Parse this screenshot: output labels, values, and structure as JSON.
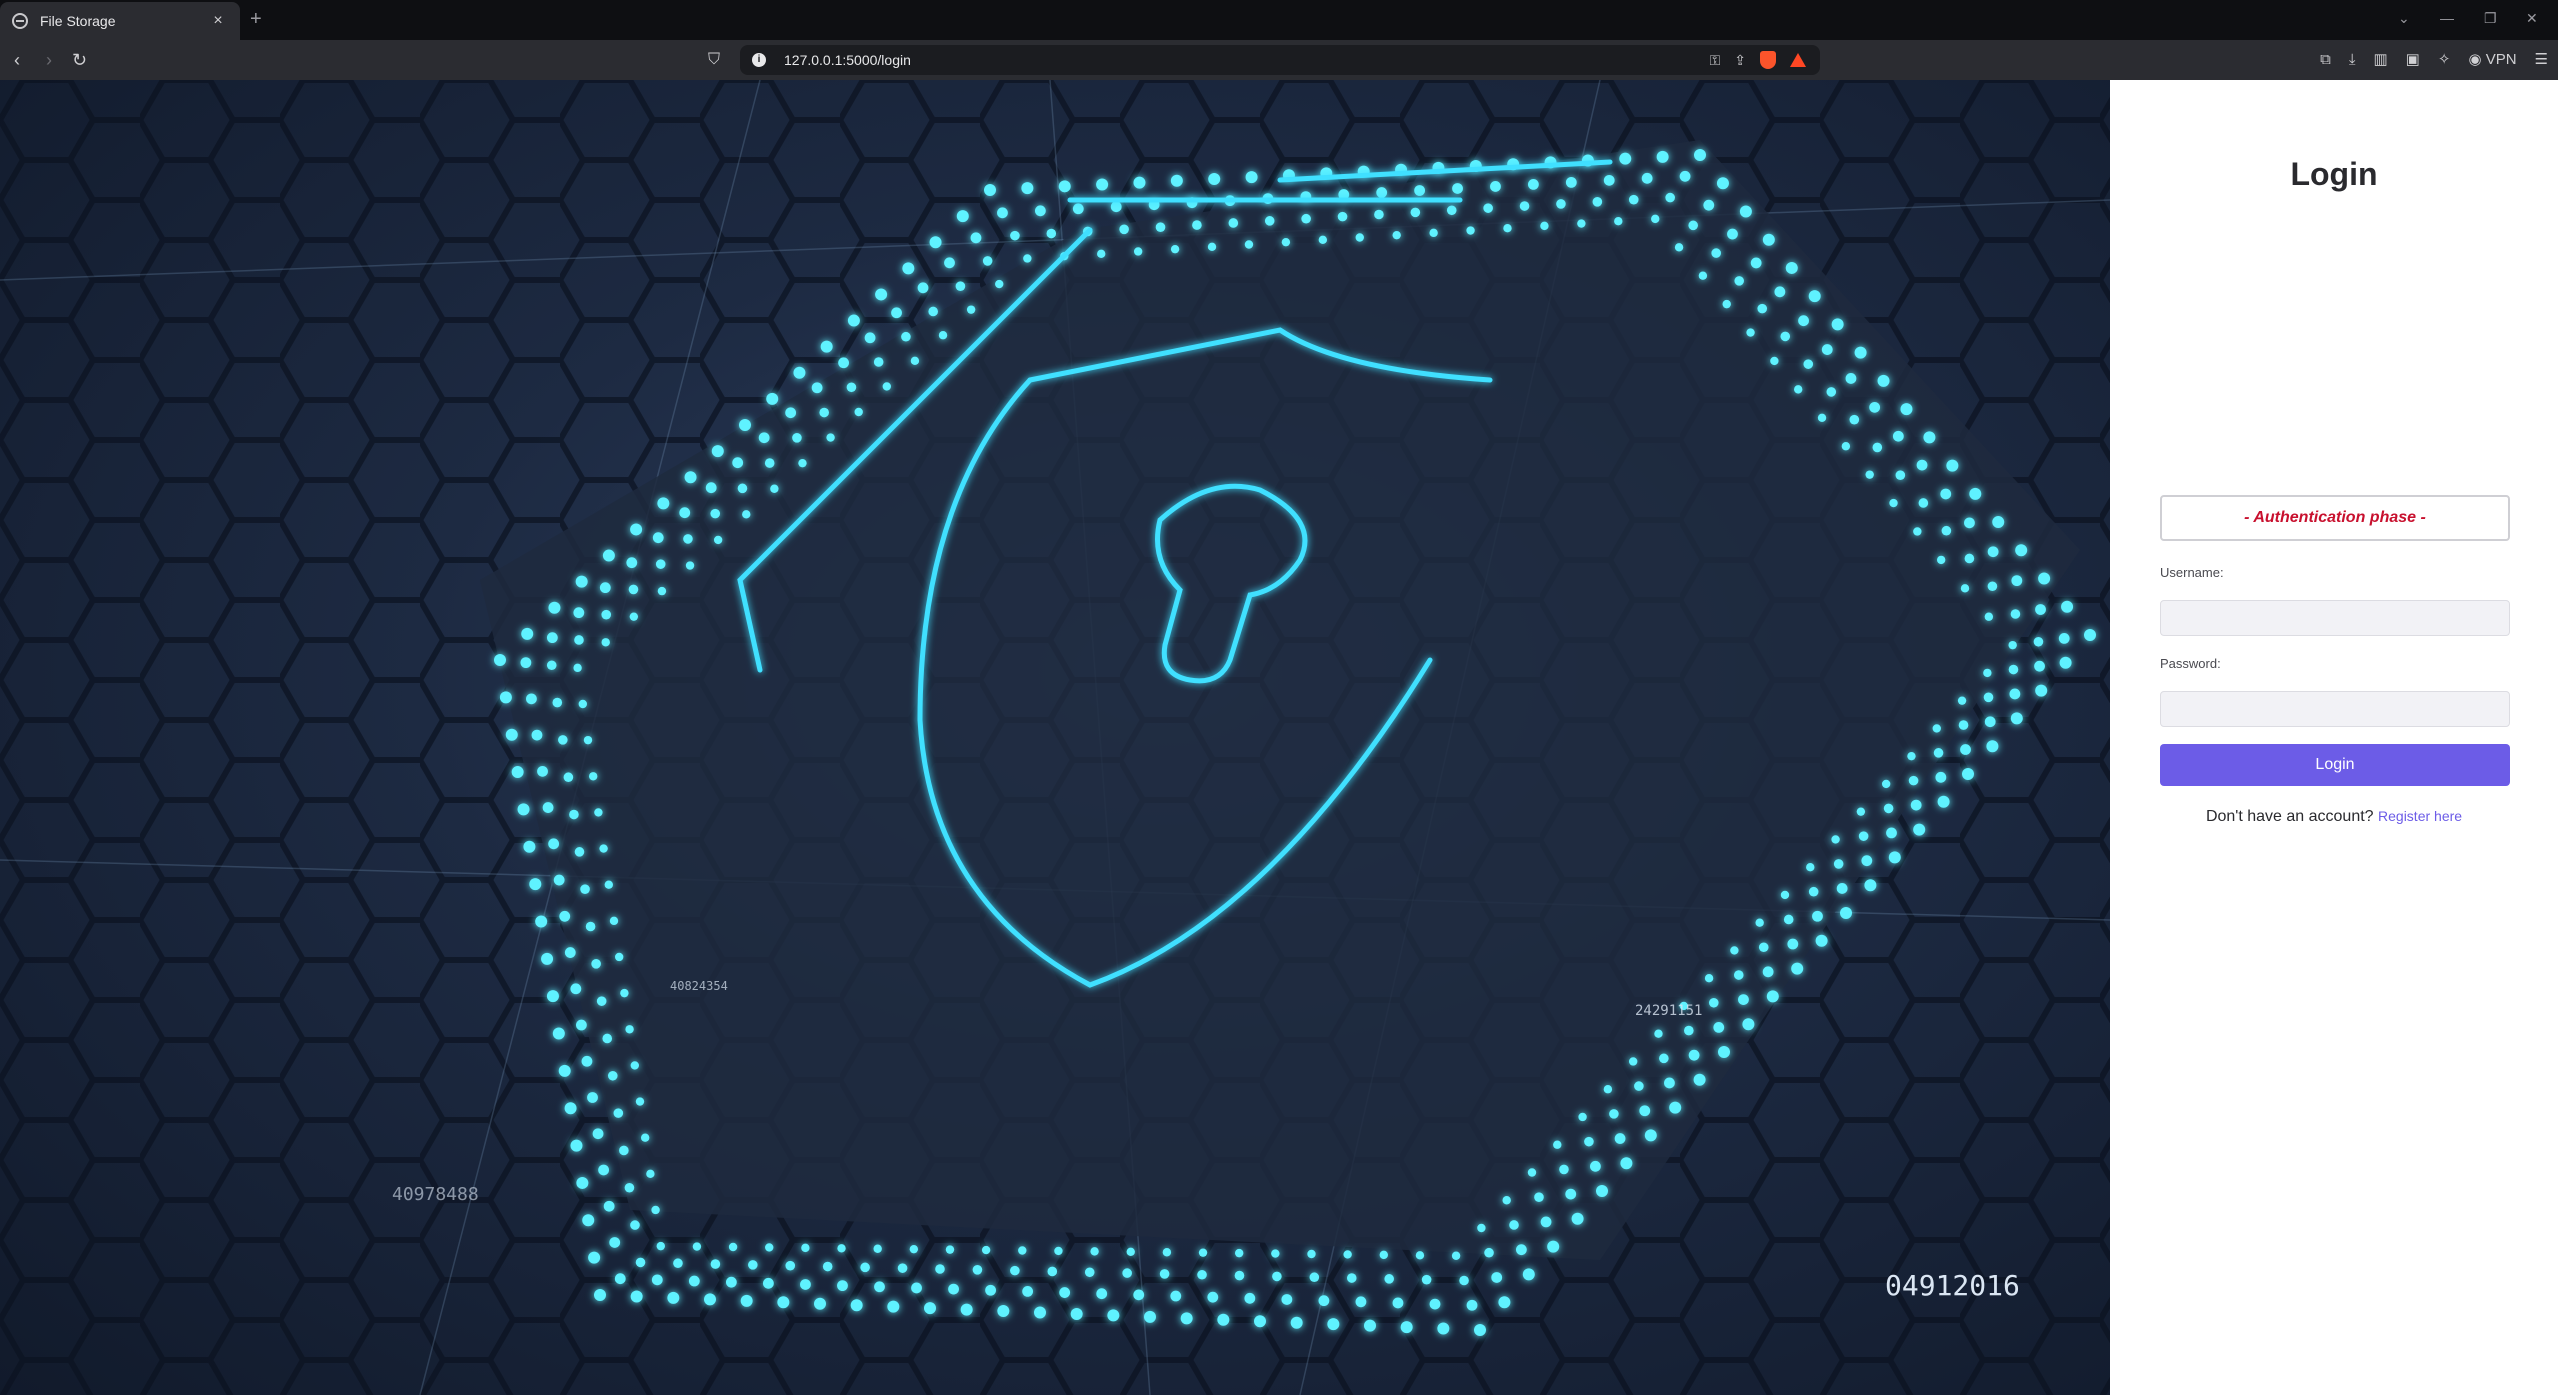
{
  "browser": {
    "tab_title": "File Storage",
    "tab_close": "×",
    "new_tab": "+",
    "url": "127.0.0.1:5000/login",
    "vpn_label": "VPN"
  },
  "hero": {
    "numbers": [
      "04912016",
      "40978488",
      "24291151",
      "40824354"
    ]
  },
  "login": {
    "title": "Login",
    "phase": "- Authentication phase -",
    "username_label": "Username:",
    "username_value": "",
    "password_label": "Password:",
    "password_value": "",
    "submit_label": "Login",
    "no_account_text": "Don't have an account?",
    "register_link": "Register here"
  },
  "colors": {
    "accent": "#6c5ce7",
    "phase_text": "#c8102e",
    "neon": "#3fe0ff"
  }
}
